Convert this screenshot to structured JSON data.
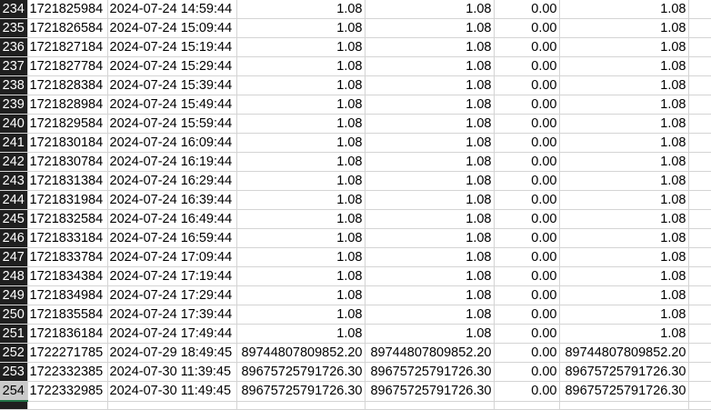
{
  "sheet": {
    "rows": [
      {
        "row": "234",
        "id": "1721825984",
        "datetime": "2024-07-24 14:59:44",
        "a": "1.08",
        "b": "1.08",
        "c": "0.00",
        "d": "1.08"
      },
      {
        "row": "235",
        "id": "1721826584",
        "datetime": "2024-07-24 15:09:44",
        "a": "1.08",
        "b": "1.08",
        "c": "0.00",
        "d": "1.08"
      },
      {
        "row": "236",
        "id": "1721827184",
        "datetime": "2024-07-24 15:19:44",
        "a": "1.08",
        "b": "1.08",
        "c": "0.00",
        "d": "1.08"
      },
      {
        "row": "237",
        "id": "1721827784",
        "datetime": "2024-07-24 15:29:44",
        "a": "1.08",
        "b": "1.08",
        "c": "0.00",
        "d": "1.08"
      },
      {
        "row": "238",
        "id": "1721828384",
        "datetime": "2024-07-24 15:39:44",
        "a": "1.08",
        "b": "1.08",
        "c": "0.00",
        "d": "1.08"
      },
      {
        "row": "239",
        "id": "1721828984",
        "datetime": "2024-07-24 15:49:44",
        "a": "1.08",
        "b": "1.08",
        "c": "0.00",
        "d": "1.08"
      },
      {
        "row": "240",
        "id": "1721829584",
        "datetime": "2024-07-24 15:59:44",
        "a": "1.08",
        "b": "1.08",
        "c": "0.00",
        "d": "1.08"
      },
      {
        "row": "241",
        "id": "1721830184",
        "datetime": "2024-07-24 16:09:44",
        "a": "1.08",
        "b": "1.08",
        "c": "0.00",
        "d": "1.08"
      },
      {
        "row": "242",
        "id": "1721830784",
        "datetime": "2024-07-24 16:19:44",
        "a": "1.08",
        "b": "1.08",
        "c": "0.00",
        "d": "1.08"
      },
      {
        "row": "243",
        "id": "1721831384",
        "datetime": "2024-07-24 16:29:44",
        "a": "1.08",
        "b": "1.08",
        "c": "0.00",
        "d": "1.08"
      },
      {
        "row": "244",
        "id": "1721831984",
        "datetime": "2024-07-24 16:39:44",
        "a": "1.08",
        "b": "1.08",
        "c": "0.00",
        "d": "1.08"
      },
      {
        "row": "245",
        "id": "1721832584",
        "datetime": "2024-07-24 16:49:44",
        "a": "1.08",
        "b": "1.08",
        "c": "0.00",
        "d": "1.08"
      },
      {
        "row": "246",
        "id": "1721833184",
        "datetime": "2024-07-24 16:59:44",
        "a": "1.08",
        "b": "1.08",
        "c": "0.00",
        "d": "1.08"
      },
      {
        "row": "247",
        "id": "1721833784",
        "datetime": "2024-07-24 17:09:44",
        "a": "1.08",
        "b": "1.08",
        "c": "0.00",
        "d": "1.08"
      },
      {
        "row": "248",
        "id": "1721834384",
        "datetime": "2024-07-24 17:19:44",
        "a": "1.08",
        "b": "1.08",
        "c": "0.00",
        "d": "1.08"
      },
      {
        "row": "249",
        "id": "1721834984",
        "datetime": "2024-07-24 17:29:44",
        "a": "1.08",
        "b": "1.08",
        "c": "0.00",
        "d": "1.08"
      },
      {
        "row": "250",
        "id": "1721835584",
        "datetime": "2024-07-24 17:39:44",
        "a": "1.08",
        "b": "1.08",
        "c": "0.00",
        "d": "1.08"
      },
      {
        "row": "251",
        "id": "1721836184",
        "datetime": "2024-07-24 17:49:44",
        "a": "1.08",
        "b": "1.08",
        "c": "0.00",
        "d": "1.08"
      },
      {
        "row": "252",
        "id": "1722271785",
        "datetime": "2024-07-29 18:49:45",
        "a": "89744807809852.20",
        "b": "89744807809852.20",
        "c": "0.00",
        "d": "89744807809852.20"
      },
      {
        "row": "253",
        "id": "1722332385",
        "datetime": "2024-07-30 11:39:45",
        "a": "89675725791726.30",
        "b": "89675725791726.30",
        "c": "0.00",
        "d": "89675725791726.30"
      },
      {
        "row": "254",
        "id": "1722332985",
        "datetime": "2024-07-30 11:49:45",
        "a": "89675725791726.30",
        "b": "89675725791726.30",
        "c": "0.00",
        "d": "89675725791726.30"
      }
    ],
    "selected_row": "254",
    "colors": {
      "row_header_bg": "#1f1f1f",
      "selected_header_bg": "#c9c9c9",
      "gridline": "#d4d4d4",
      "selection_accent": "#217346"
    }
  }
}
